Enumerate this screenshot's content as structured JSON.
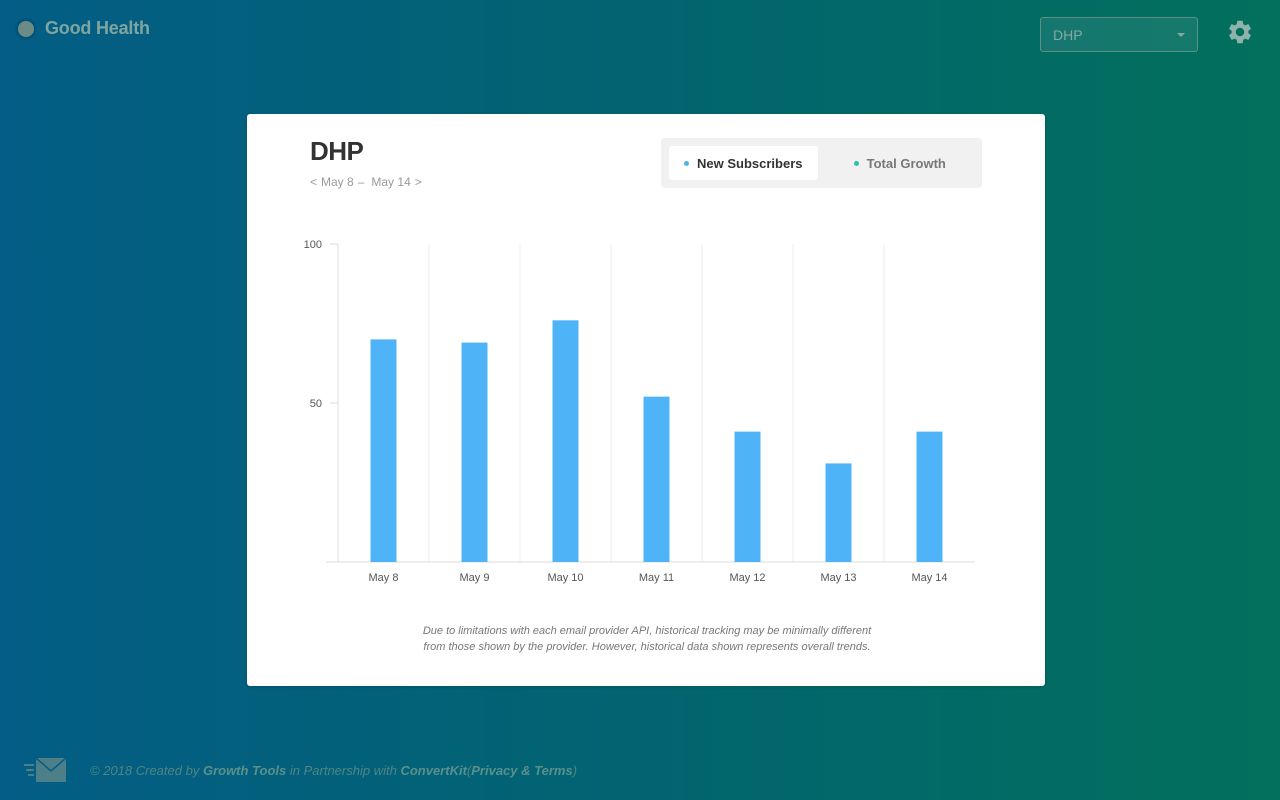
{
  "app": {
    "brand_name": "Good Health",
    "account_selected": "DHP"
  },
  "card": {
    "title": "DHP",
    "date_range": {
      "prev": "<",
      "start": "May 8",
      "separator": "–",
      "end": "May 14",
      "next": ">"
    },
    "tabs": [
      {
        "label": "New Subscribers",
        "active": true,
        "dot_color": "#4db6e8"
      },
      {
        "label": "Total Growth",
        "active": false,
        "dot_color": "#2ec4a0"
      }
    ],
    "disclaimer": "Due to limitations with each email provider API, historical tracking may be minimally different from those shown by the provider. However, historical data shown represents overall trends."
  },
  "chart_data": {
    "type": "bar",
    "categories": [
      "May 8",
      "May 9",
      "May 10",
      "May 11",
      "May 12",
      "May 13",
      "May 14"
    ],
    "values": [
      70,
      69,
      76,
      52,
      41,
      31,
      41
    ],
    "ylim": [
      0,
      100
    ],
    "yticks": [
      "50",
      "100"
    ],
    "bar_color": "#4fb4f7",
    "grid": "vertical"
  },
  "footer": {
    "prefix": "© 2018 Created by",
    "growth_tools": "Growth Tools",
    "middle": "in Partnership with",
    "convertkit": "ConvertKit",
    "open_paren": "(",
    "privacy": "Privacy",
    "amp": "&",
    "terms": "Terms",
    "close_paren": ")"
  },
  "icons": {
    "brand": "status-dot-icon",
    "settings": "gear-icon",
    "footer": "mail-icon"
  }
}
